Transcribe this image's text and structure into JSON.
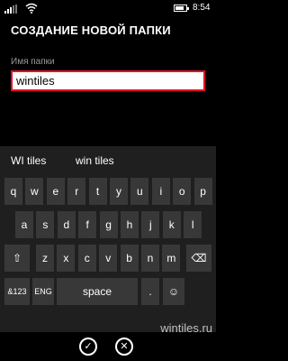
{
  "status": {
    "time": "8:54"
  },
  "title": "СОЗДАНИЕ НОВОЙ ПАПКИ",
  "field": {
    "label": "Имя папки",
    "value": "wintiles"
  },
  "suggestions": [
    "WI tiles",
    "win tiles"
  ],
  "keys": {
    "row1": [
      "q",
      "w",
      "e",
      "r",
      "t",
      "y",
      "u",
      "i",
      "o",
      "p"
    ],
    "row2": [
      "a",
      "s",
      "d",
      "f",
      "g",
      "h",
      "j",
      "k",
      "l"
    ],
    "row3": [
      "z",
      "x",
      "c",
      "v",
      "b",
      "n",
      "m"
    ],
    "shift": "⇧",
    "backspace": "⌫",
    "symbols": "&123",
    "lang": "ENG",
    "space": "space",
    "period": ".",
    "emoji": "☺"
  },
  "nav": {
    "accept": "✓",
    "cancel": "✕"
  },
  "watermark": "wintiles.ru",
  "colors": {
    "accent": "#e81123",
    "keyboard_bg": "#1f1f1f",
    "key_bg": "#383838"
  }
}
